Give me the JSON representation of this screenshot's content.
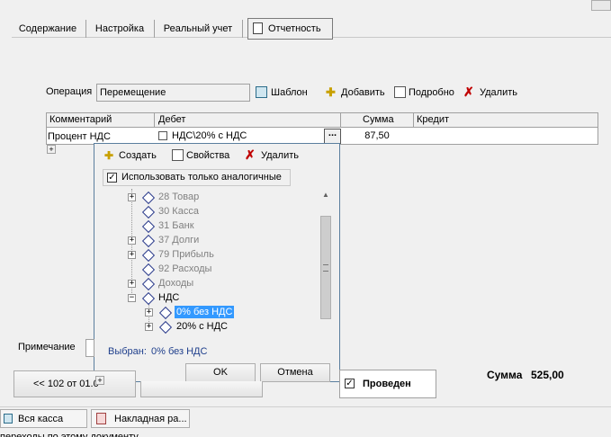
{
  "tabs": [
    {
      "label": "Содержание"
    },
    {
      "label": "Настройка"
    },
    {
      "label": "Реальный учет"
    },
    {
      "label": "Отчетность"
    }
  ],
  "operation": {
    "label": "Операция",
    "value": "Перемещение",
    "template_label": "Шаблон",
    "add_label": "Добавить",
    "details_label": "Подробно",
    "delete_label": "Удалить"
  },
  "grid": {
    "headers": [
      "Комментарий",
      "Дебет",
      "Сумма",
      "Кредит"
    ],
    "row": {
      "comment": "Процент НДС",
      "debit": "НДС\\20% с НДС",
      "amount": "87,50",
      "credit": ""
    }
  },
  "popup": {
    "create_label": "Создать",
    "props_label": "Свойства",
    "delete_label": "Удалить",
    "checkbox_label": "Использовать только аналогичные",
    "tree": [
      {
        "label": "28 Товар",
        "gray": true
      },
      {
        "label": "30 Касса",
        "gray": true
      },
      {
        "label": "31 Банк",
        "gray": true
      },
      {
        "label": "37 Долги",
        "gray": true
      },
      {
        "label": "79 Прибыль",
        "gray": true
      },
      {
        "label": "92 Расходы",
        "gray": true
      },
      {
        "label": "Доходы",
        "gray": true
      },
      {
        "label": "НДС",
        "gray": false
      },
      {
        "label": "0% без НДС",
        "gray": false
      },
      {
        "label": "20% с НДС",
        "gray": false
      }
    ],
    "selected_label": "Выбран:",
    "selected_value": "0% без НДС",
    "ok_label": "OK",
    "cancel_label": "Отмена"
  },
  "bottom": {
    "note_label": "Примечание",
    "nav_label": "<< 102 от 01.0",
    "posted_label": "Проведен",
    "sum_label": "Сумма",
    "sum_value": "525,00"
  },
  "taskbar": [
    {
      "label": "Вся касса"
    },
    {
      "label": "Накладная ра..."
    }
  ],
  "footer_text": "переходы по этому документу"
}
